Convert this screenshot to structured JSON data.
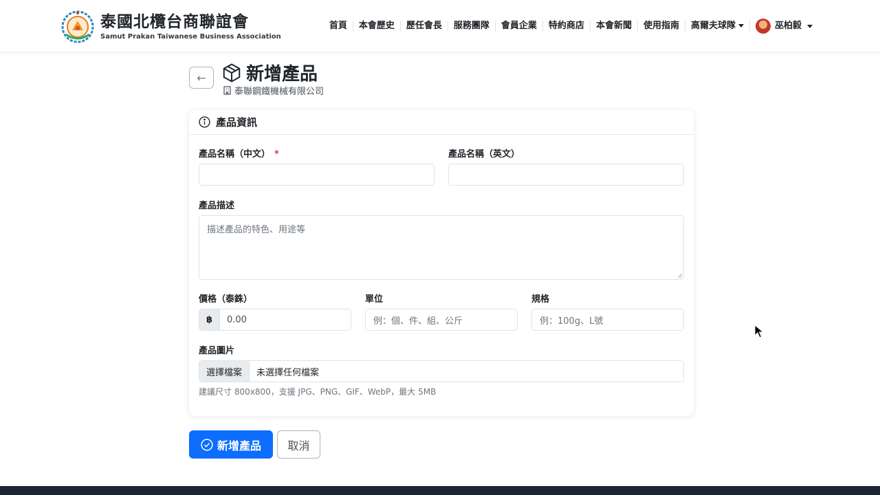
{
  "brand": {
    "title": "泰國北欖台商聯誼會",
    "subtitle": "Samut Prakan Taiwanese Business Association"
  },
  "nav": {
    "items": [
      "首頁",
      "本會歷史",
      "歷任會長",
      "服務團隊",
      "會員企業",
      "特約商店",
      "本會新聞",
      "使用指南"
    ],
    "golf_label": "高爾夫球隊",
    "user_name": "巫柏毅"
  },
  "page": {
    "title": "新增產品",
    "company": "泰聯鋼鐵機械有限公司"
  },
  "card": {
    "header": "產品資訊"
  },
  "form": {
    "name_zh_label": "產品名稱（中文）",
    "required_mark": "*",
    "name_en_label": "產品名稱（英文）",
    "description_label": "產品描述",
    "description_placeholder": "描述產品的特色、用途等",
    "price_label": "價格（泰銖）",
    "price_symbol": "฿",
    "price_value": "0.00",
    "unit_label": "單位",
    "unit_placeholder": "例：個、件、組、公斤",
    "spec_label": "規格",
    "spec_placeholder": "例：100g、L號",
    "image_label": "產品圖片",
    "file_button": "選擇檔案",
    "file_status": "未選擇任何檔案",
    "image_hint": "建議尺寸 800x800，支援 JPG、PNG、GIF、WebP，最大 5MB"
  },
  "actions": {
    "submit_label": "新增產品",
    "cancel_label": "取消"
  },
  "colors": {
    "primary": "#0d6efd",
    "required": "#dc3545",
    "footer": "#1d2433"
  }
}
